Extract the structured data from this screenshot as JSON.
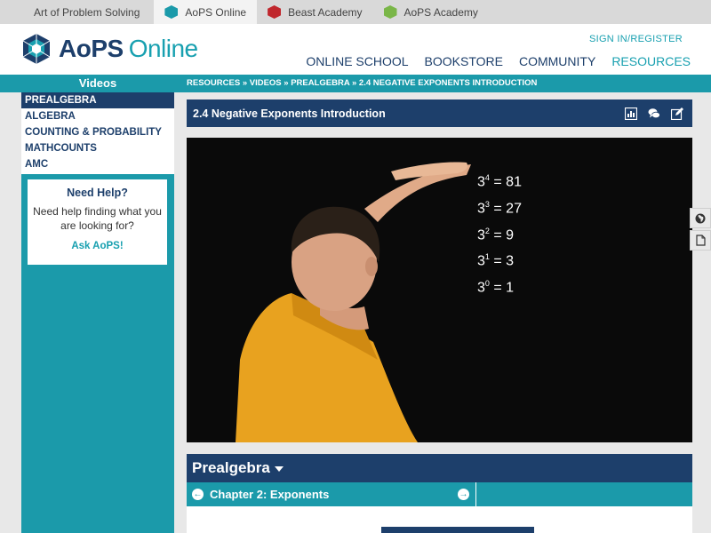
{
  "topbar": {
    "sites": [
      "Art of Problem Solving",
      "AoPS Online",
      "Beast Academy",
      "AoPS Academy"
    ]
  },
  "header": {
    "logo_brand": "AoPS",
    "logo_product": "Online",
    "signin": "SIGN IN/REGISTER",
    "nav": [
      "ONLINE SCHOOL",
      "BOOKSTORE",
      "COMMUNITY",
      "RESOURCES"
    ]
  },
  "band": {
    "title": "Videos",
    "breadcrumb": "RESOURCES » VIDEOS » PREALGEBRA » 2.4 NEGATIVE EXPONENTS INTRODUCTION"
  },
  "sidebar": {
    "items": [
      "PREALGEBRA",
      "ALGEBRA",
      "COUNTING & PROBABILITY",
      "MATHCOUNTS",
      "AMC"
    ],
    "help": {
      "title": "Need Help?",
      "text": "Need help finding what you are looking for?",
      "link": "Ask AoPS!"
    }
  },
  "video": {
    "title": "2.4 Negative Exponents Introduction",
    "equations": [
      {
        "base": "3",
        "exp": "4",
        "result": "= 81"
      },
      {
        "base": "3",
        "exp": "3",
        "result": "= 27"
      },
      {
        "base": "3",
        "exp": "2",
        "result": "= 9"
      },
      {
        "base": "3",
        "exp": "1",
        "result": "= 3"
      },
      {
        "base": "3",
        "exp": "0",
        "result": "= 1"
      }
    ]
  },
  "course": {
    "name": "Prealgebra",
    "chapter": "Chapter 2: Exponents"
  },
  "colors": {
    "navy": "#1d3f6b",
    "teal": "#1b9aaa"
  }
}
